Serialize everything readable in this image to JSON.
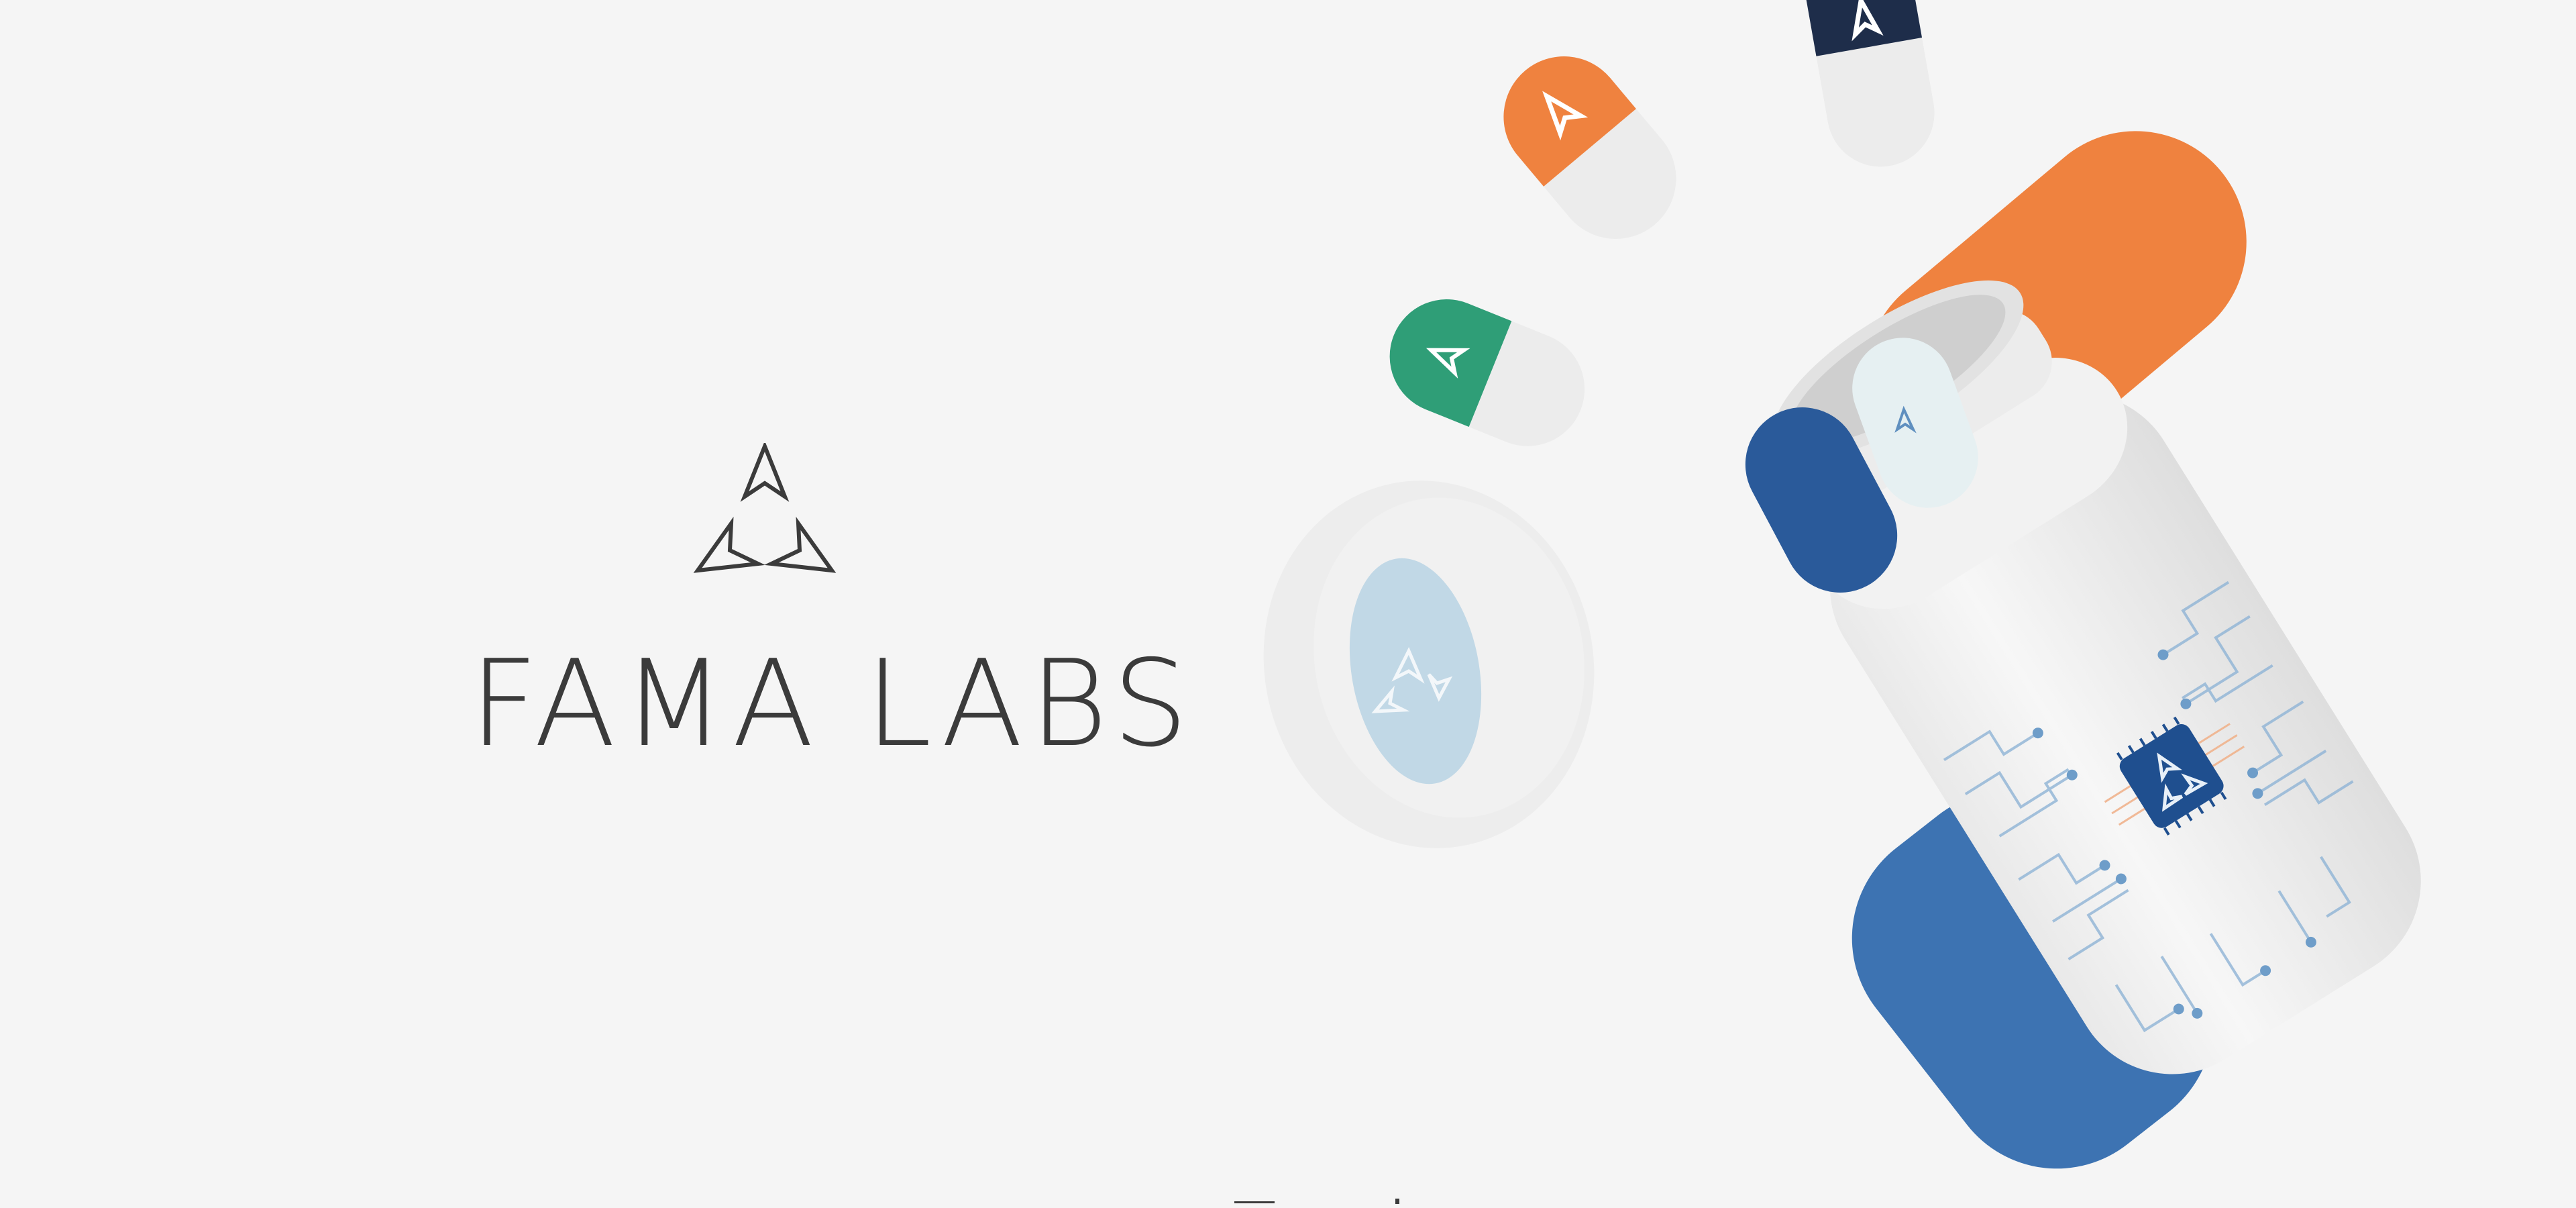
{
  "brand": {
    "name": "FAMA LABS",
    "logo_icon": "triangle-arrows-logo-icon"
  },
  "hero": {
    "illustration": "supplement-bottle-with-capsules",
    "colors": {
      "background": "#f5f5f5",
      "orange": "#ef823f",
      "navy": "#1e2d4a",
      "green": "#2f9e77",
      "blue": "#3d73b2",
      "dark_blue": "#1f4f8f",
      "light_blue_label": "#b9d4e4",
      "text": "#3b3b3b"
    }
  }
}
